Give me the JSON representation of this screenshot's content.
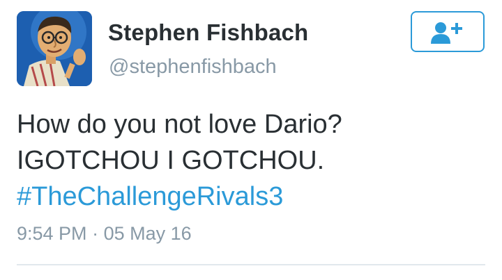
{
  "user": {
    "display_name": "Stephen Fishbach",
    "handle": "@stephenfishbach",
    "avatar_icon": "cartoon-avatar"
  },
  "follow_button": {
    "icon": "follow-user-plus-icon"
  },
  "tweet": {
    "line1": "How do you not love Dario?",
    "line2": "IGOTCHOU I GOTCHOU.",
    "hashtag": "#TheChallengeRivals3"
  },
  "timestamp": {
    "time": "9:54 PM",
    "separator": " · ",
    "date": "05 May 16"
  },
  "colors": {
    "accent": "#2b9ad8",
    "text": "#292f33",
    "muted": "#8899a6",
    "divider": "#e1e8ed"
  }
}
